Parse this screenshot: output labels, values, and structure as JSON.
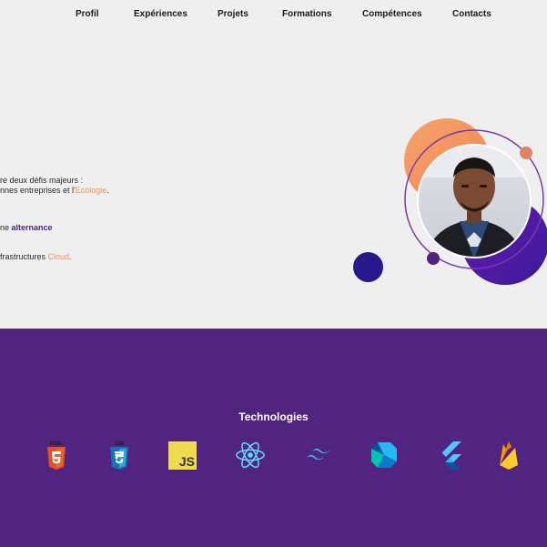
{
  "nav": {
    "items": [
      "Profil",
      "Expériences",
      "Projets",
      "Formations",
      "Compétences",
      "Contacts"
    ]
  },
  "hero": {
    "line1": "re deux défis majeurs :",
    "line2_prefix": "nnes entreprises et l'",
    "line2_highlight": "Ecologie",
    "line2_suffix": ".",
    "line3_prefix": "ne ",
    "line3_highlight": "alternance",
    "line4_prefix": "frastructures ",
    "line4_highlight": "Cloud",
    "line4_suffix": "."
  },
  "technologies": {
    "title": "Technologies",
    "icons": [
      "html5-icon",
      "css3-icon",
      "javascript-icon",
      "react-icon",
      "tailwind-icon",
      "dart-icon",
      "flutter-icon",
      "firebase-icon"
    ],
    "html_label": "HTML",
    "css_label": "CSS",
    "js_label": "JS"
  },
  "colors": {
    "purple": "#51247f",
    "orange": "#f0905a",
    "navy": "#27198c"
  }
}
